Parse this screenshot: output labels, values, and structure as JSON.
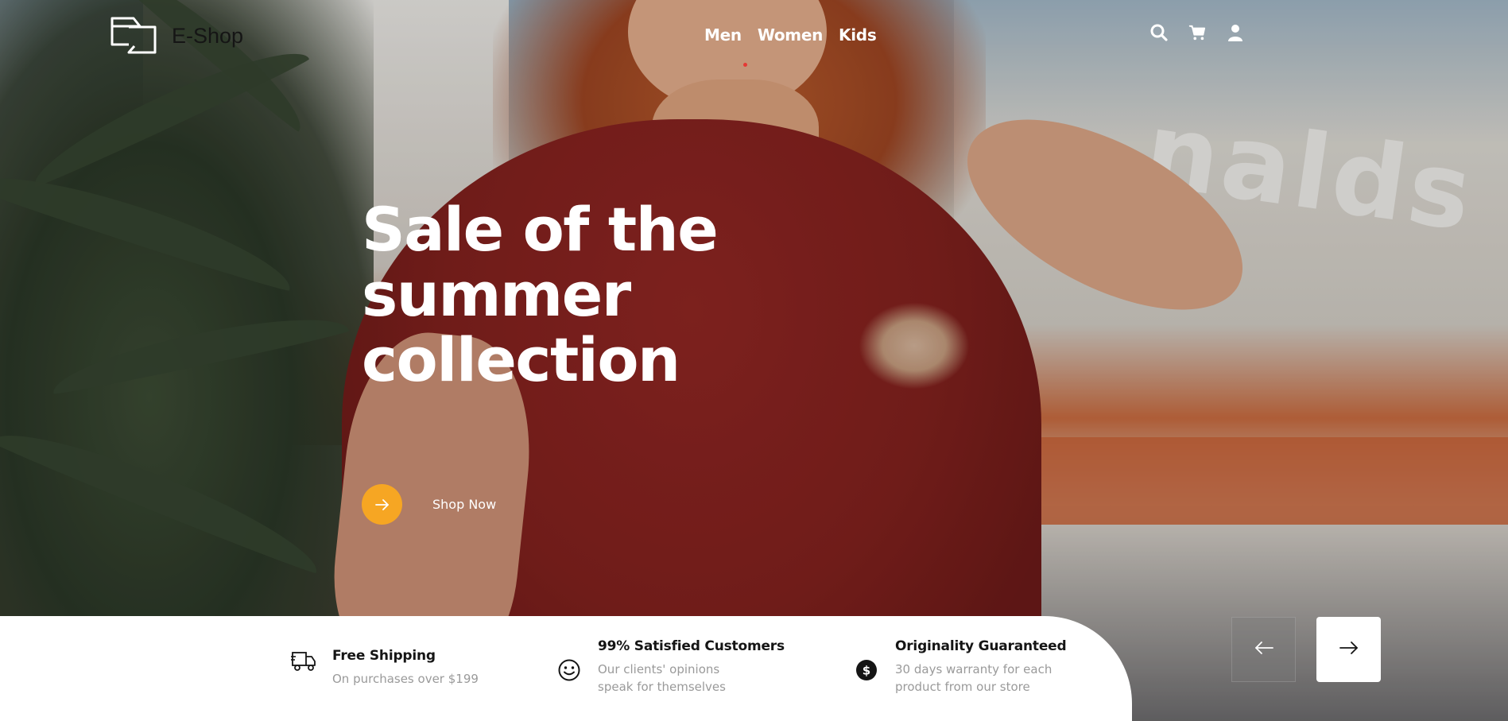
{
  "brand": {
    "name": "E-Shop",
    "logo_icon": "logo-mark-icon"
  },
  "nav": {
    "items": [
      {
        "label": "Men",
        "active": true
      },
      {
        "label": "Women",
        "active": false
      },
      {
        "label": "Kids",
        "active": false
      }
    ],
    "active_indicator_color": "#e53935"
  },
  "header_icons": [
    "search-icon",
    "cart-icon",
    "user-icon"
  ],
  "hero": {
    "title_lines": [
      "Sale of the",
      "summer",
      "collection"
    ],
    "cta_label": "Shop Now",
    "cta_icon": "arrow-right-icon",
    "cta_color": "#f6a623"
  },
  "features": [
    {
      "icon": "delivery-truck-icon",
      "title": "Free Shipping",
      "subtitle_lines": [
        "On purchases over $199"
      ]
    },
    {
      "icon": "smile-icon",
      "title": "99% Satisfied Customers",
      "subtitle_lines": [
        "Our clients' opinions",
        "speak for themselves"
      ]
    },
    {
      "icon": "dollar-icon",
      "title": "Originality Guaranteed",
      "subtitle_lines": [
        "30 days warranty for each",
        "product from our store"
      ]
    }
  ],
  "slider": {
    "prev_icon": "arrow-left-icon",
    "next_icon": "arrow-right-icon"
  },
  "colors": {
    "text_dark": "#151515",
    "text_muted": "#9a9a9a",
    "white": "#ffffff"
  }
}
